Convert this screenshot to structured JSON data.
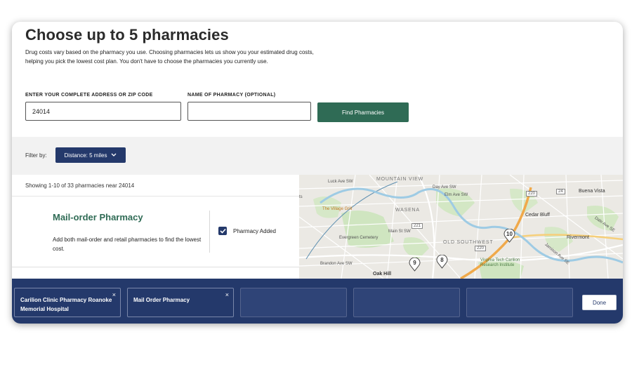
{
  "header": {
    "title": "Choose up to 5 pharmacies",
    "description": "Drug costs vary based on the pharmacy you use. Choosing pharmacies lets us show you your estimated drug costs, helping you pick the lowest cost plan. You don't have to choose the pharmacies you currently use."
  },
  "search": {
    "address_label": "ENTER YOUR COMPLETE ADDRESS OR ZIP CODE",
    "address_value": "24014",
    "pharmacy_label": "NAME OF PHARMACY (OPTIONAL)",
    "pharmacy_value": "",
    "find_button": "Find Pharmacies"
  },
  "filter": {
    "label": "Filter by:",
    "distance": "Distance: 5 miles"
  },
  "results": {
    "showing": "Showing 1-10 of 33 pharmacies near 24014",
    "mail_order": {
      "title": "Mail-order Pharmacy",
      "description": "Add both mail-order and retail pharmacies to find the lowest cost.",
      "checkbox_label": "Pharmacy Added",
      "checked": true
    }
  },
  "map": {
    "labels": {
      "mountain_view": "MOUNTAIN VIEW",
      "wasena": "WASENA",
      "old_southwest": "OLD SOUTHWEST",
      "oak_hill": "Oak Hill",
      "evergreen": "Evergreen Cemetery",
      "village_grill": "The Village Grill",
      "luck_ave": "Luck Ave SW",
      "day_ave": "Day Ave SW",
      "elm_ave": "Elm Ave SW",
      "main_st": "Main St SW",
      "brandon": "Brandon Ave SW",
      "buena_vista": "Buena Vista",
      "cedar_bluff": "Cedar Bluff",
      "rivermont": "Rivermont",
      "vt_carilion": "Virginia Tech Carilion Research Institute",
      "rte_221": "221",
      "rte_220": "220",
      "rte_24": "24",
      "rte_220b": "220",
      "dale": "Dale Ave SE",
      "jamison": "Jamison Ave SE",
      "ts": "ts"
    },
    "pins": [
      "10",
      "9",
      "8"
    ]
  },
  "selected": {
    "slots": [
      {
        "name": "Carilion Clinic Pharmacy Roanoke Memorial Hospital",
        "close": "×"
      },
      {
        "name": "Mail Order Pharmacy",
        "close": "×"
      }
    ],
    "done": "Done"
  },
  "colors": {
    "brand_green": "#2f6b55",
    "navy": "#24396b"
  },
  "icons": {
    "chevron": "chevron-down-icon",
    "check": "check-icon",
    "close": "close-icon",
    "pin": "map-pin-icon"
  }
}
